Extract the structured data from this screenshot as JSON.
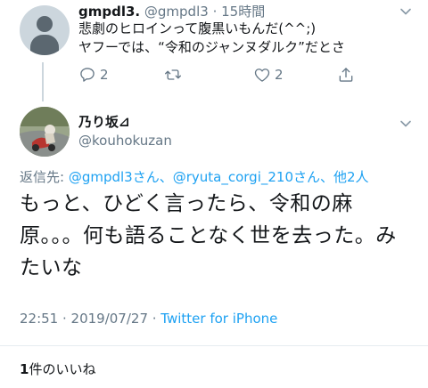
{
  "parent_tweet": {
    "display_name": "gmpdl3.",
    "handle": "@gmpdl3",
    "separator": "·",
    "time": "15時間",
    "lines": [
      "悲劇のヒロインって腹黒いもんだ(^^;)",
      "ヤフーでは、“令和のジャンヌダルク”だとさ"
    ],
    "reply_count": "2",
    "retweet_count": "",
    "like_count": "2"
  },
  "main_tweet": {
    "display_name": "乃り坂⊿",
    "handle": "@kouhokuzan",
    "reply_to_label": "返信先: ",
    "reply_to_targets": "@gmpdl3さん、@ryuta_corgi_210さん、他2人",
    "text": "もっと、ひどく言ったら、令和の麻原。。。何も語ることなく世を去った。みたいな",
    "timestamp": "22:51 · 2019/07/27 · ",
    "source": "Twitter for iPhone",
    "likes_number": "1",
    "likes_label": "件のいいね"
  },
  "icons": {
    "reply": "reply-icon",
    "retweet": "retweet-icon",
    "like": "heart-icon",
    "share": "share-icon",
    "menu": "chevron-down-icon"
  },
  "colors": {
    "link": "#1da1f2",
    "secondary_text": "#657786",
    "primary_text": "#14171a",
    "divider": "#e6ecf0"
  }
}
